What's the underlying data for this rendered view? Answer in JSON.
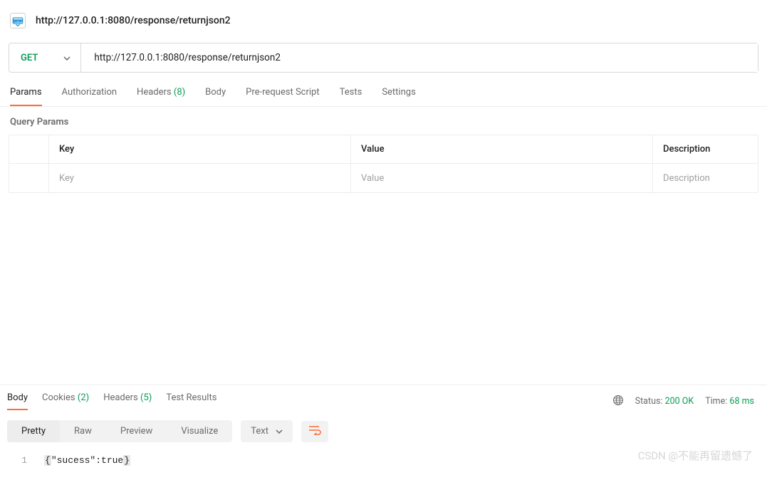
{
  "header": {
    "title": "http://127.0.0.1:8080/response/returnjson2"
  },
  "request": {
    "method": "GET",
    "url": "http://127.0.0.1:8080/response/returnjson2",
    "tabs": {
      "params": "Params",
      "auth": "Authorization",
      "headers": "Headers",
      "headers_count": "(8)",
      "body": "Body",
      "prerequest": "Pre-request Script",
      "tests": "Tests",
      "settings": "Settings"
    }
  },
  "params": {
    "section_label": "Query Params",
    "headers": {
      "key": "Key",
      "value": "Value",
      "description": "Description"
    },
    "placeholders": {
      "key": "Key",
      "value": "Value",
      "description": "Description"
    }
  },
  "response": {
    "tabs": {
      "body": "Body",
      "cookies": "Cookies",
      "cookies_count": "(2)",
      "headers": "Headers",
      "headers_count": "(5)",
      "tests": "Test Results"
    },
    "meta": {
      "status_label": "Status:",
      "status_value": "200 OK",
      "time_label": "Time:",
      "time_value": "68 ms"
    },
    "view_modes": {
      "pretty": "Pretty",
      "raw": "Raw",
      "preview": "Preview",
      "visualize": "Visualize"
    },
    "format": "Text",
    "body_lines": [
      "{\"sucess\":true}"
    ],
    "line_num": "1"
  },
  "watermark": "CSDN @不能再留遗憾了"
}
